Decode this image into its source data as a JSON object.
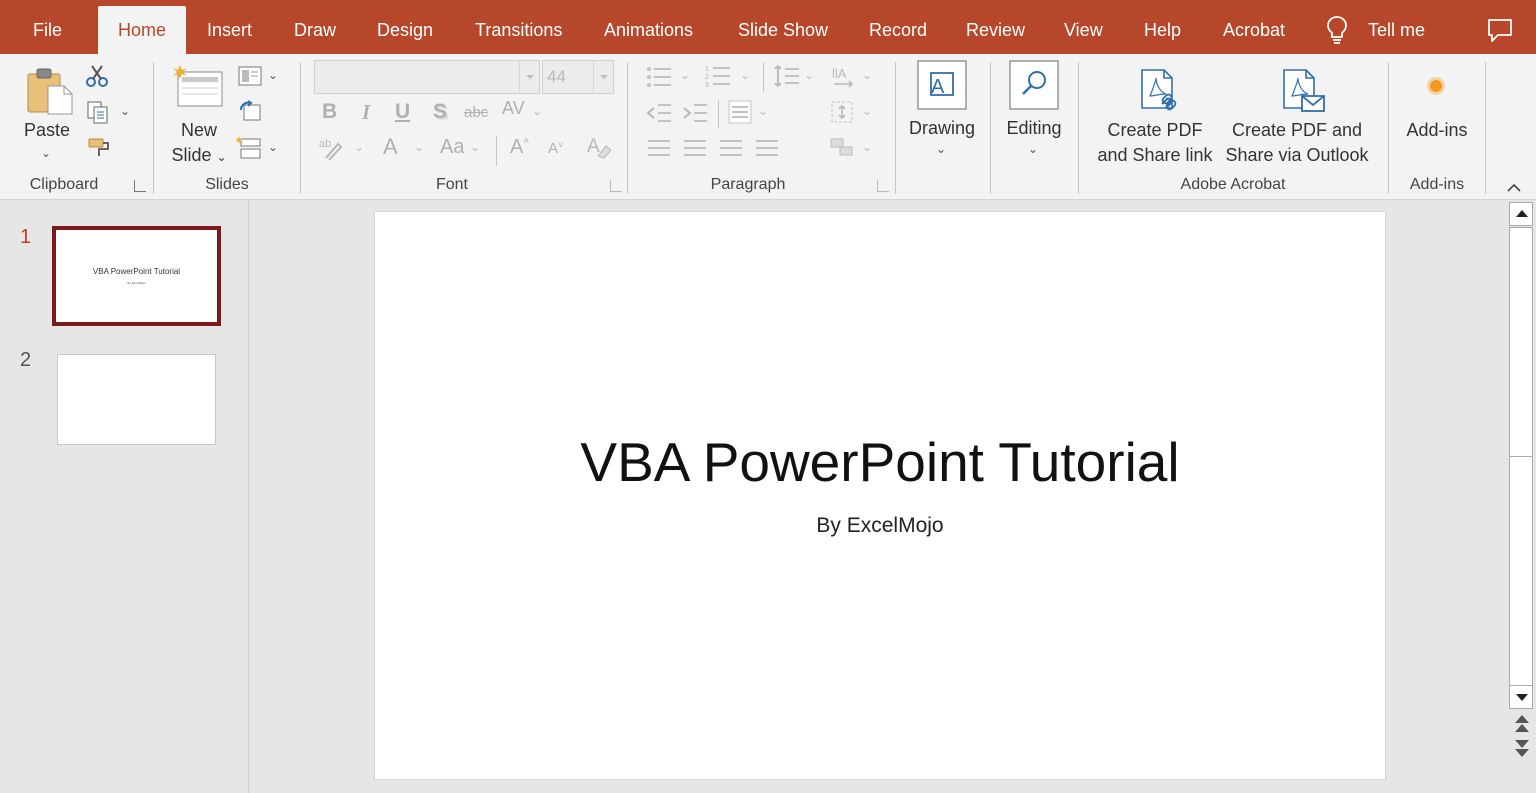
{
  "tabs": [
    {
      "label": "File",
      "active": false
    },
    {
      "label": "Home",
      "active": true
    },
    {
      "label": "Insert",
      "active": false
    },
    {
      "label": "Draw",
      "active": false
    },
    {
      "label": "Design",
      "active": false
    },
    {
      "label": "Transitions",
      "active": false
    },
    {
      "label": "Animations",
      "active": false
    },
    {
      "label": "Slide Show",
      "active": false
    },
    {
      "label": "Record",
      "active": false
    },
    {
      "label": "Review",
      "active": false
    },
    {
      "label": "View",
      "active": false
    },
    {
      "label": "Help",
      "active": false
    },
    {
      "label": "Acrobat",
      "active": false
    }
  ],
  "tell_me": "Tell me",
  "ribbon": {
    "clipboard": {
      "paste_label": "Paste",
      "group_label": "Clipboard"
    },
    "slides": {
      "new_slide_line1": "New",
      "new_slide_line2": "Slide",
      "group_label": "Slides"
    },
    "font": {
      "font_name": "",
      "font_size": "44",
      "group_label": "Font"
    },
    "paragraph": {
      "group_label": "Paragraph"
    },
    "drawing": {
      "label": "Drawing"
    },
    "editing": {
      "label": "Editing"
    },
    "acrobat": {
      "create_share_link_line1": "Create PDF",
      "create_share_link_line2": "and Share link",
      "create_share_outlook_line1": "Create PDF and",
      "create_share_outlook_line2": "Share via Outlook",
      "group_label": "Adobe Acrobat"
    },
    "addins": {
      "label": "Add-ins",
      "group_label": "Add-ins"
    }
  },
  "slides": [
    {
      "number": "1",
      "title": "VBA PowerPoint Tutorial",
      "subtitle": "By ExcelMojo",
      "selected": true
    },
    {
      "number": "2",
      "title": "",
      "subtitle": "",
      "selected": false
    }
  ],
  "current_slide": {
    "title": "VBA PowerPoint Tutorial",
    "subtitle": "By ExcelMojo"
  },
  "colors": {
    "accent": "#b7472a",
    "ribbon_bg": "#f3f3f3",
    "selected_thumb_border": "#7a1a1a"
  }
}
